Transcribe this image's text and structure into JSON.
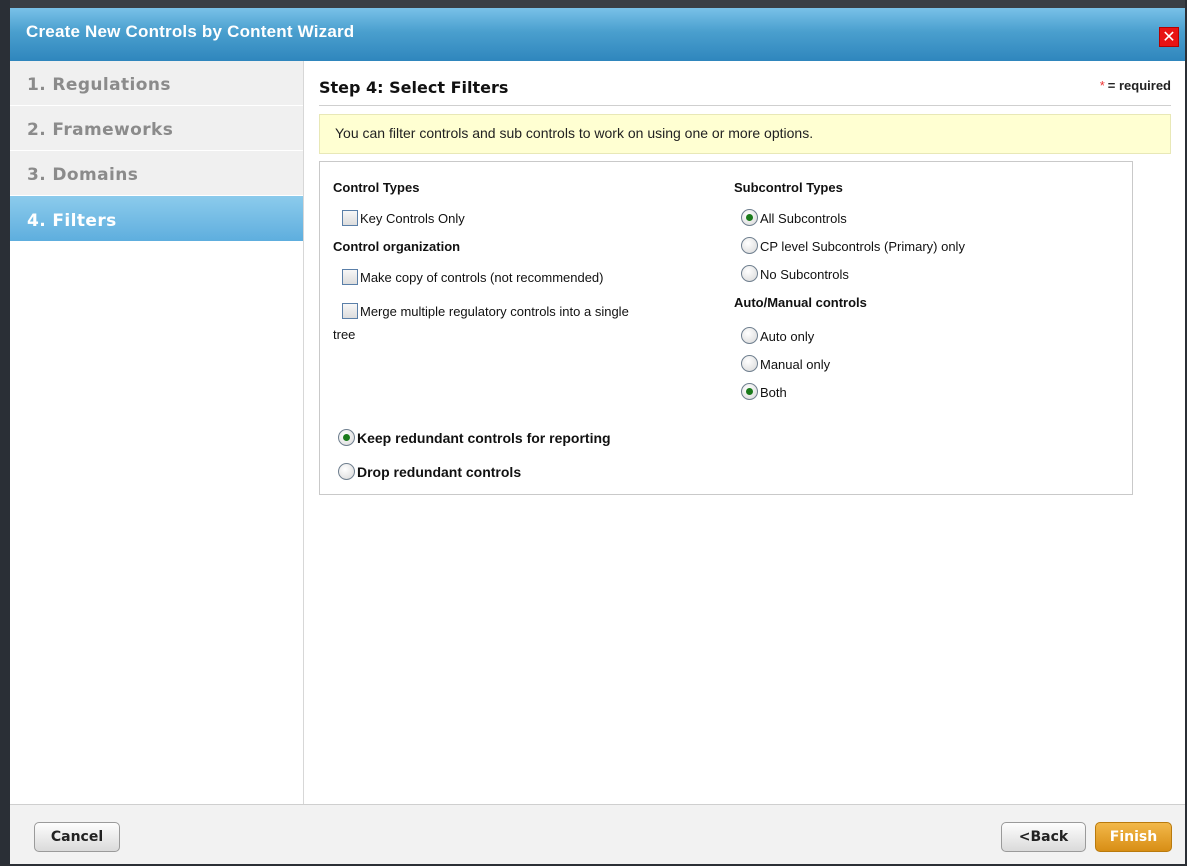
{
  "window": {
    "title": "Create New Controls by Content Wizard",
    "close_icon": "close-icon",
    "close_glyph": "✕"
  },
  "sidebar": {
    "steps": [
      {
        "label": "1. Regulations"
      },
      {
        "label": "2. Frameworks"
      },
      {
        "label": "3. Domains"
      },
      {
        "label": "4. Filters",
        "active": true
      }
    ]
  },
  "main": {
    "step_title": "Step 4: Select Filters",
    "required_star": "*",
    "required_text": "= required",
    "info_text": "You can filter controls and sub controls to work on using one or more options."
  },
  "filters": {
    "control_types": {
      "heading": "Control Types",
      "key_controls_only": "Key Controls Only"
    },
    "control_organization": {
      "heading": "Control organization",
      "make_copy": "Make copy of controls (not recommended)",
      "merge_line1": "Merge multiple regulatory controls into a single",
      "merge_line2": "tree"
    },
    "redundant": {
      "keep": "Keep redundant controls for reporting",
      "drop": "Drop redundant controls"
    },
    "subcontrol_types": {
      "heading": "Subcontrol Types",
      "all": "All Subcontrols",
      "cp_level": "CP level Subcontrols (Primary) only",
      "none": "No Subcontrols"
    },
    "auto_manual": {
      "heading": "Auto/Manual controls",
      "auto": "Auto only",
      "manual": "Manual only",
      "both": "Both"
    }
  },
  "footer": {
    "cancel": "Cancel",
    "back": "<Back",
    "finish": "Finish"
  },
  "colors": {
    "titlebar": "#4a9fce",
    "active_step": "#6fb9e4",
    "info_box": "#ffffd2",
    "finish_button": "#e39b24"
  }
}
